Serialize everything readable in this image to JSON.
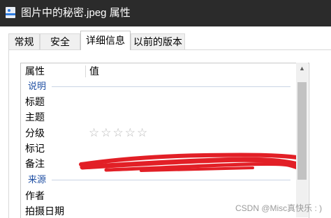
{
  "window": {
    "title": "图片中的秘密.jpeg 属性"
  },
  "tabs": [
    {
      "label": "常规"
    },
    {
      "label": "安全"
    },
    {
      "label": "详细信息"
    },
    {
      "label": "以前的版本"
    }
  ],
  "active_tab": "详细信息",
  "list": {
    "columns": {
      "property": "属性",
      "value": "值"
    },
    "groups": [
      {
        "name": "说明",
        "items": [
          "标题",
          "主题",
          "分级",
          "标记",
          "备注"
        ]
      },
      {
        "name": "来源",
        "items": [
          "作者",
          "拍摄日期"
        ]
      }
    ],
    "rating": {
      "stars_total": 5,
      "stars_filled": 0,
      "glyphs": "☆☆☆☆☆"
    }
  },
  "redaction_color": "#e21f26",
  "watermark": "CSDN @Misc真快乐 : )",
  "icons": {
    "title": "image-file-icon",
    "scroll_up": "chevron-up-icon"
  },
  "colors": {
    "titlebar_bg": "#2b2b2b",
    "group_header": "#1f4fa3"
  }
}
